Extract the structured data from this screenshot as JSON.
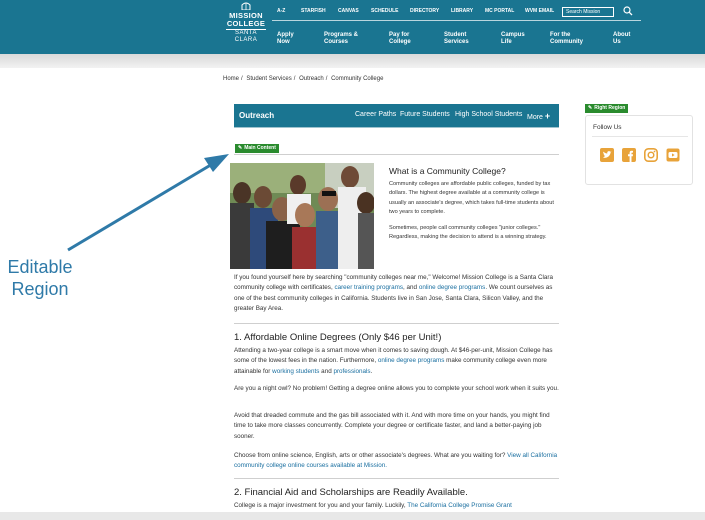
{
  "header": {
    "logo_line1": "MISSION",
    "logo_line2": "COLLEGE",
    "logo_line3": "SANTA CLARA",
    "utility_links": [
      "A-Z",
      "STARFISH",
      "CANVAS",
      "SCHEDULE",
      "DIRECTORY",
      "LIBRARY",
      "MC PORTAL",
      "WVM EMAIL"
    ],
    "search_placeholder": "Search Mission",
    "nav": [
      "Apply Now",
      "Programs & Courses",
      "Pay for College",
      "Student Services",
      "Campus Life",
      "For the Community",
      "About Us"
    ],
    "color": "#1a7591"
  },
  "breadcrumb": [
    "Home",
    "Student Services",
    "Outreach",
    "Community College"
  ],
  "section_nav": {
    "title": "Outreach",
    "links": [
      "Career Paths",
      "Future Students",
      "High School Students"
    ],
    "more": "More"
  },
  "badges": {
    "main": "Main Content",
    "right": "Right Region"
  },
  "intro": {
    "title": "What is a Community College?",
    "p1": "Community colleges are affordable public colleges, funded by tax dollars. The highest degree available at a community college is usually an associate's degree, which takes full-time students about two years to complete.",
    "p2": "Sometimes, people call community colleges \"junior colleges.\" Regardless, making the decision to attend is a winning strategy."
  },
  "welcome": {
    "t1": "If you found yourself here by searching \"community colleges near me,\" Welcome! Mission College is a Santa Clara community college with certificates, ",
    "l1": "career training programs",
    "t2": ", and ",
    "l2": "online degree programs",
    "t3": ". We count ourselves as one of the best community colleges in California. Students live in San Jose, Santa Clara, Silicon Valley, and the greater Bay Area."
  },
  "section1": {
    "title": "1. Affordable Online Degrees (Only $46 per Unit!)",
    "p1_t1": "Attending a two-year college is a smart move when it comes to saving dough. At $46-per-unit, Mission College has some of the lowest fees in the nation. Furthermore, ",
    "p1_l1": "online degree programs",
    "p1_t2": " make community college even more attainable for ",
    "p1_l2": "working students",
    "p1_t3": " and ",
    "p1_l3": "professionals",
    "p1_t4": ".",
    "p2": "Are you a night owl? No problem! Getting a degree online allows you to complete your school work when it suits you.",
    "p3": "Avoid that dreaded commute and the gas bill associated with it. And with more time on your hands, you might find time to take more classes concurrently. Complete your degree or certificate faster, and land a better-paying job sooner.",
    "p4_t1": "Choose from online science, English, arts or other associate's degrees. What are you waiting for? ",
    "p4_l1": "View all California community college online courses available at Mission."
  },
  "section2": {
    "title": "2. Financial Aid and Scholarships are Readily Available.",
    "p1_t1": "College is a major investment for you and your family. Luckily, ",
    "p1_l1": "The California College Promise Grant"
  },
  "right_region": {
    "follow_label": "Follow Us",
    "icons": [
      "twitter-icon",
      "facebook-icon",
      "instagram-icon",
      "youtube-icon"
    ],
    "icon_color": "#e8a33a"
  },
  "annotation": {
    "line1": "Editable",
    "line2": "Region",
    "color": "#2f7aa8"
  }
}
